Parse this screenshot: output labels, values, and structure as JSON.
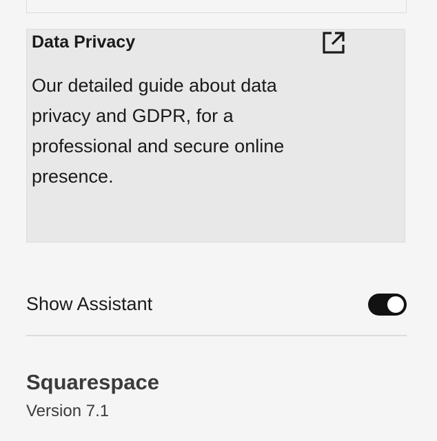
{
  "privacy_card": {
    "title": "Data Privacy",
    "description": "Our detailed guide about data privacy and GDPR, for a professional and secure online presence.",
    "link_icon": "external-link-icon"
  },
  "assistant": {
    "label": "Show Assistant",
    "enabled": true
  },
  "footer": {
    "brand": "Squarespace",
    "version": "Version 7.1"
  },
  "colors": {
    "background": "#f5f5f5",
    "card_background": "#e8e8e8",
    "toggle_on": "#121212"
  }
}
